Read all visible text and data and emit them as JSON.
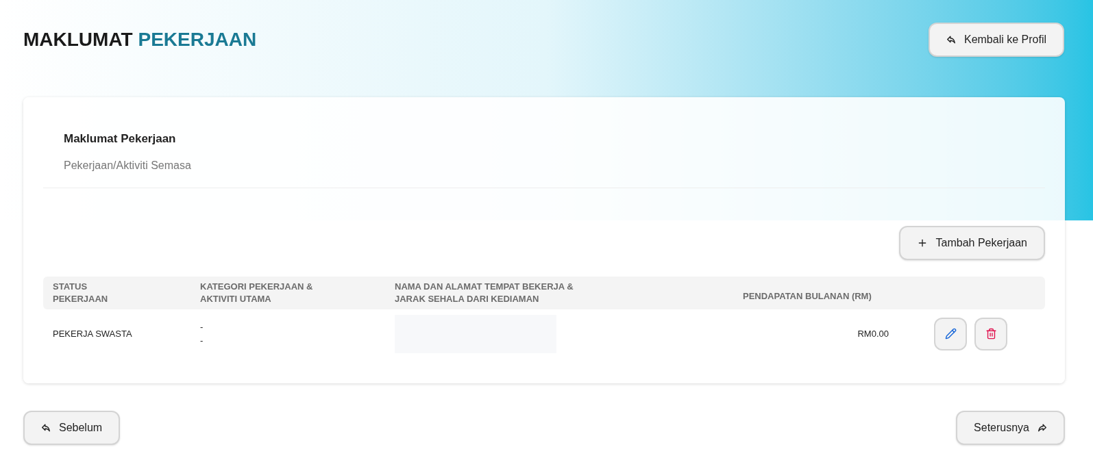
{
  "page_title": {
    "first": "MAKLUMAT",
    "second": "PEKERJAAN"
  },
  "back_to_profile": "Kembali ke Profil",
  "section": {
    "title": "Maklumat Pekerjaan",
    "subtitle": "Pekerjaan/Aktiviti Semasa"
  },
  "add_button": "Tambah Pekerjaan",
  "table": {
    "columns": [
      "STATUS PEKERJAAN",
      "KATEGORI PEKERJAAN & AKTIVITI UTAMA",
      "NAMA DAN ALAMAT TEMPAT BEKERJA & JARAK SEHALA DARI KEDIAMAN",
      "PENDAPATAN BULANAN (RM)"
    ],
    "rows": [
      {
        "status": "PEKERJA SWASTA",
        "category": [
          "-",
          "-"
        ],
        "income": "RM0.00"
      }
    ]
  },
  "nav": {
    "previous": "Sebelum",
    "next": "Seterusnya"
  }
}
